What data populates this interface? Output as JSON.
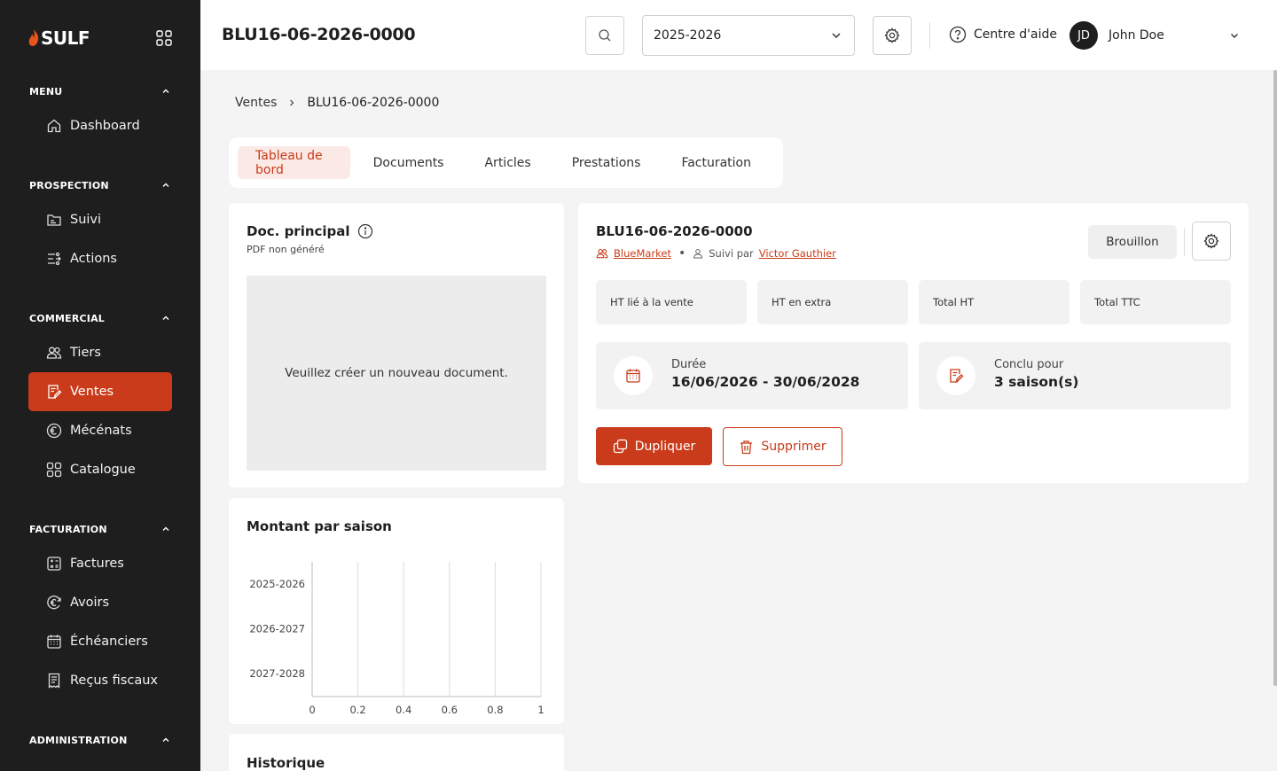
{
  "sidebar": {
    "logo": "SULF",
    "sections": [
      {
        "title": "MENU",
        "items": [
          {
            "label": "Dashboard",
            "icon": "home-icon"
          }
        ]
      },
      {
        "title": "PROSPECTION",
        "items": [
          {
            "label": "Suivi",
            "icon": "folder-icon"
          },
          {
            "label": "Actions",
            "icon": "actions-icon"
          }
        ]
      },
      {
        "title": "COMMERCIAL",
        "items": [
          {
            "label": "Tiers",
            "icon": "users-icon"
          },
          {
            "label": "Ventes",
            "icon": "document-edit-icon",
            "active": true
          },
          {
            "label": "Mécénats",
            "icon": "euro-icon"
          },
          {
            "label": "Catalogue",
            "icon": "grid-icon"
          }
        ]
      },
      {
        "title": "FACTURATION",
        "items": [
          {
            "label": "Factures",
            "icon": "calculator-icon"
          },
          {
            "label": "Avoirs",
            "icon": "euro-refund-icon"
          },
          {
            "label": "Échéanciers",
            "icon": "calendar-icon"
          },
          {
            "label": "Reçus fiscaux",
            "icon": "receipt-icon"
          }
        ]
      },
      {
        "title": "ADMINISTRATION",
        "items": []
      }
    ]
  },
  "topbar": {
    "title": "BLU16-06-2026-0000",
    "season": "2025-2026",
    "help": "Centre d'aide",
    "user_initials": "JD",
    "user_name": "John Doe"
  },
  "breadcrumb": {
    "parent": "Ventes",
    "current": "BLU16-06-2026-0000"
  },
  "tabs": [
    {
      "label": "Tableau de bord",
      "active": true
    },
    {
      "label": "Documents"
    },
    {
      "label": "Articles"
    },
    {
      "label": "Prestations"
    },
    {
      "label": "Facturation"
    }
  ],
  "doc": {
    "title": "Doc. principal",
    "subtitle": "PDF non généré",
    "placeholder": "Veuillez créer un nouveau document."
  },
  "chart": {
    "title": "Montant par saison"
  },
  "chart_data": {
    "type": "bar",
    "orientation": "horizontal",
    "categories": [
      "2025-2026",
      "2026-2027",
      "2027-2028"
    ],
    "values": [
      0,
      0,
      0
    ],
    "xticks": [
      0,
      0.2,
      0.4,
      0.6,
      0.8,
      1
    ],
    "xlim": [
      0,
      1
    ],
    "title": "Montant par saison",
    "grid": true
  },
  "history": {
    "title": "Historique"
  },
  "main": {
    "title": "BLU16-06-2026-0000",
    "client": "BlueMarket",
    "followed_prefix": "Suivi par",
    "followed_by": "Victor Gauthier",
    "status": "Brouillon",
    "stats": [
      "HT lié à la vente",
      "HT en extra",
      "Total HT",
      "Total TTC"
    ],
    "duration_label": "Durée",
    "duration_value": "16/06/2026 - 30/06/2028",
    "concluded_label": "Conclu pour",
    "concluded_value": "3 saison(s)",
    "duplicate": "Dupliquer",
    "delete": "Supprimer"
  },
  "colors": {
    "accent": "#c93b1a",
    "sidebar": "#1e1e1e",
    "accent_light": "#fbe9e5"
  }
}
